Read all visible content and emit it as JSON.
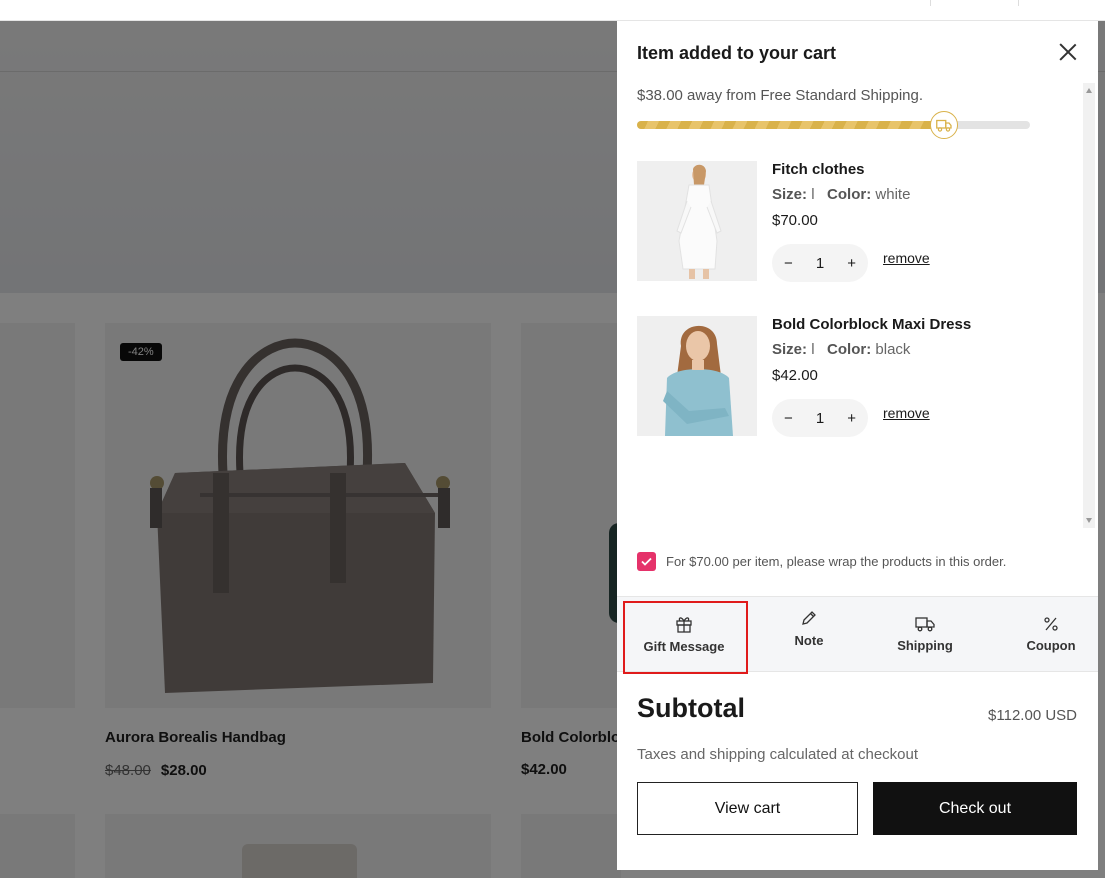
{
  "background": {
    "products": [
      {
        "title": "Aurora Borealis Handbag",
        "old_price": "$48.00",
        "price": "$28.00",
        "badge": "-42%"
      },
      {
        "title": "Bold Colorblo",
        "price": "$42.00"
      }
    ]
  },
  "drawer": {
    "title": "Item added to your cart",
    "shipping_text": "$38.00 away from Free Standard Shipping.",
    "shipping_progress": 0.78,
    "items": [
      {
        "name": "Fitch clothes",
        "size_label": "Size:",
        "size": "l",
        "color_label": "Color:",
        "color": "white",
        "price": "$70.00",
        "qty": "1",
        "remove": "remove"
      },
      {
        "name": "Bold Colorblock Maxi Dress",
        "size_label": "Size:",
        "size": "l",
        "color_label": "Color:",
        "color": "black",
        "price": "$42.00",
        "qty": "1",
        "remove": "remove"
      }
    ],
    "gift_wrap": {
      "checked": true,
      "text": "For $70.00 per item, please wrap the products in this order."
    },
    "tools": [
      {
        "label": "Gift Message",
        "icon": "gift-icon"
      },
      {
        "label": "Note",
        "icon": "pencil-icon"
      },
      {
        "label": "Shipping",
        "icon": "truck-icon"
      },
      {
        "label": "Coupon",
        "icon": "percent-icon"
      }
    ],
    "subtotal_label": "Subtotal",
    "subtotal_value": "$112.00 USD",
    "tax_note": "Taxes and shipping calculated at checkout",
    "view_cart": "View cart",
    "checkout": "Check out"
  },
  "colors": {
    "accent_gold": "#d9b24a",
    "checkbox_pink": "#e5326a",
    "highlight_red": "#e01b1b",
    "button_dark": "#111111"
  }
}
